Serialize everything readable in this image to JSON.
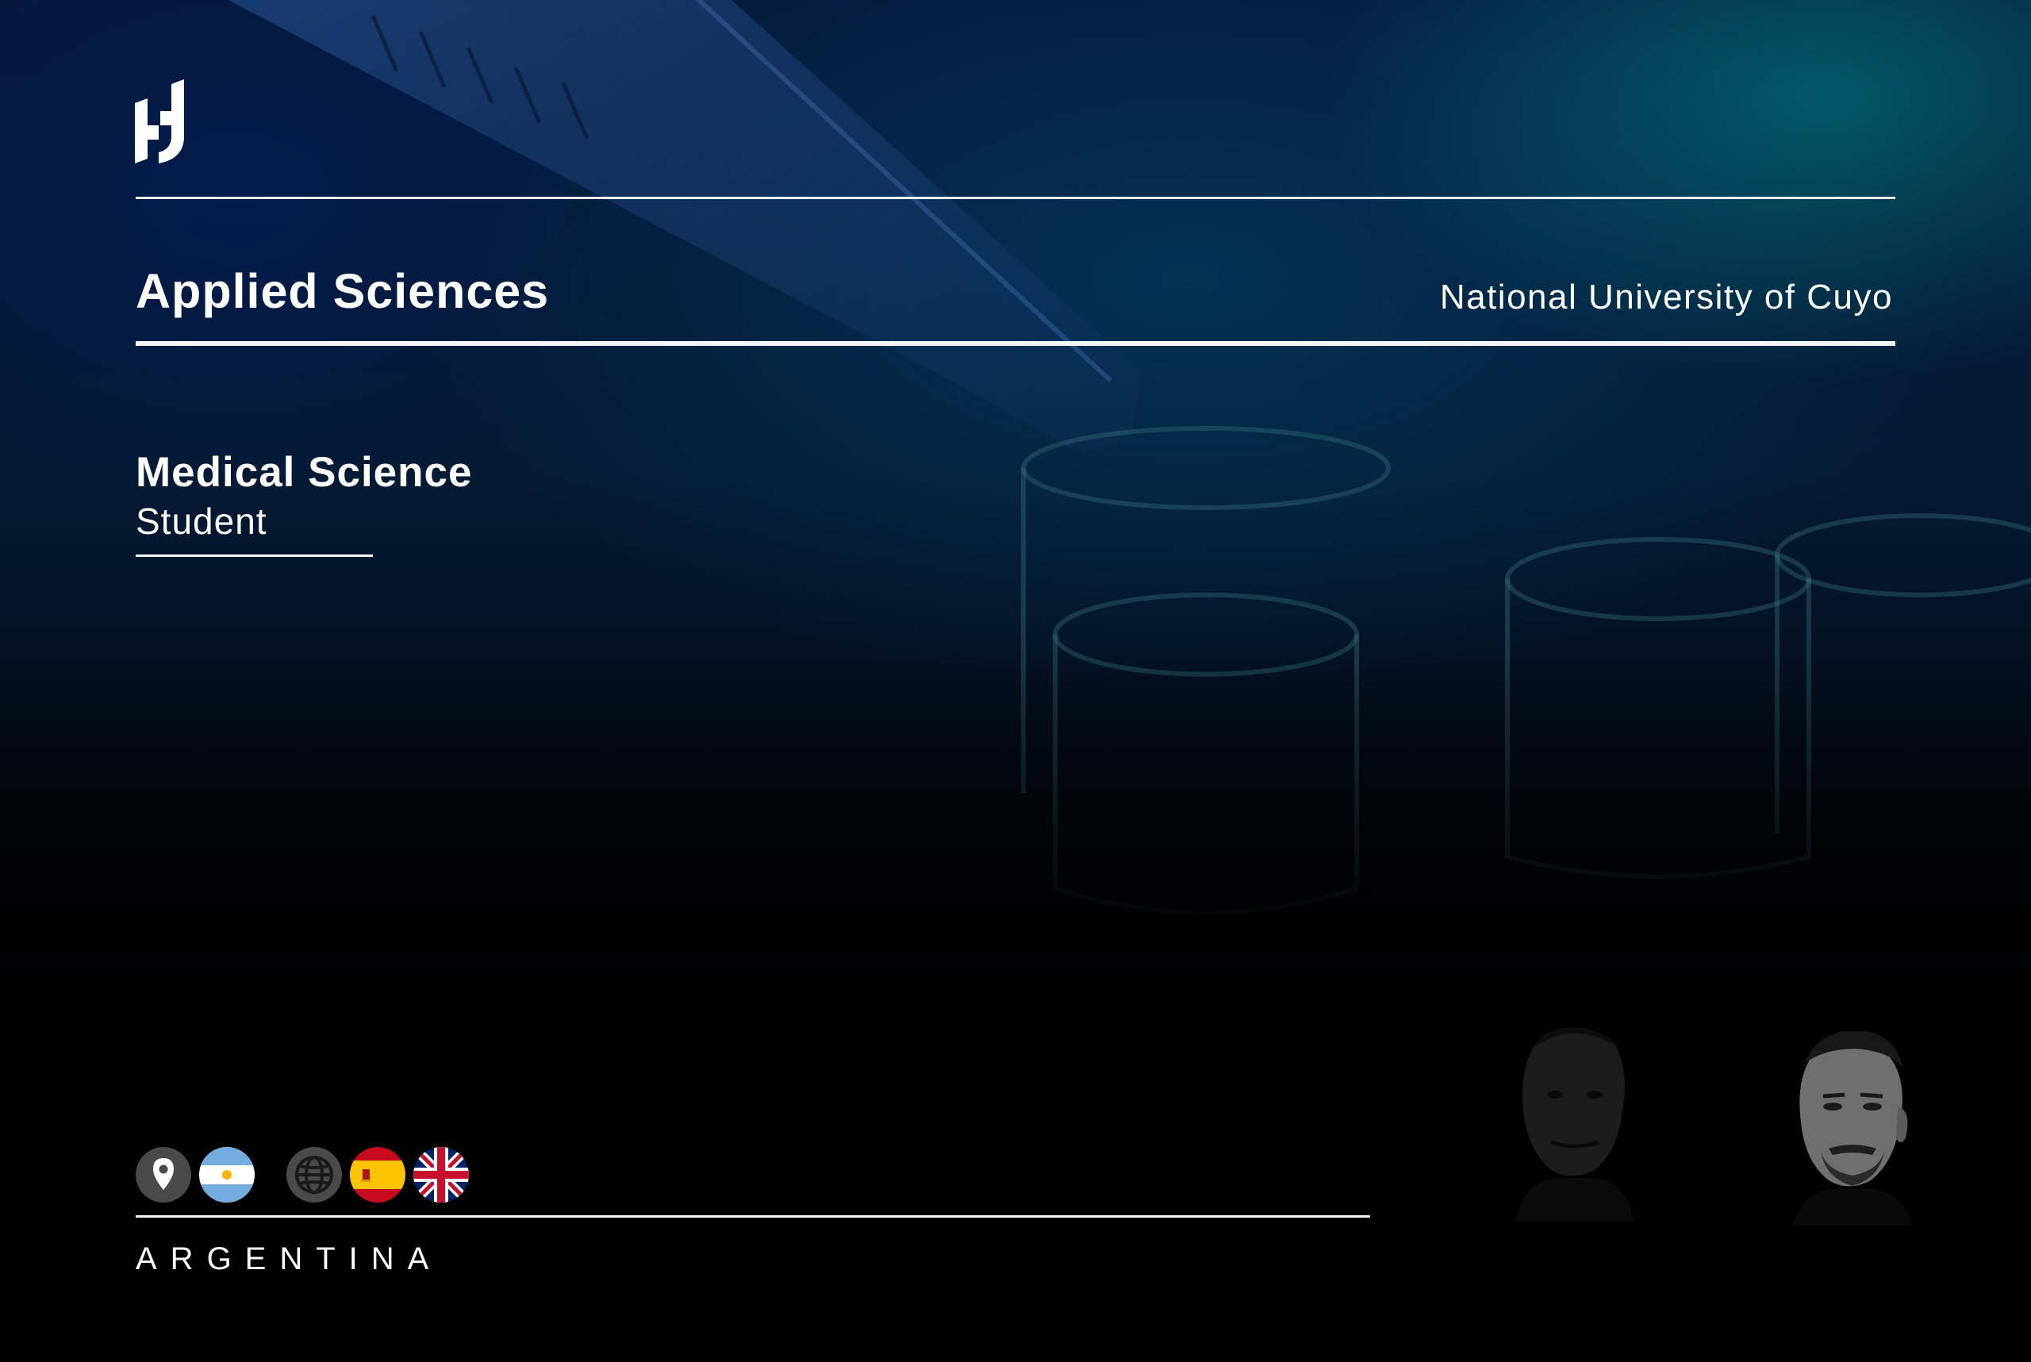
{
  "logo": {
    "icon": "monogram-h-logo"
  },
  "header": {
    "title": "Applied Sciences",
    "university": "National University of Cuyo"
  },
  "profile": {
    "field": "Medical Science",
    "role": "Student"
  },
  "footer": {
    "icons": [
      "location-pin-icon",
      "argentina-flag-icon",
      "globe-icon",
      "spain-flag-icon",
      "uk-flag-icon"
    ],
    "country": "ARGENTINA"
  },
  "colors": {
    "background": "#000000",
    "accent_teal": "#0a7f80",
    "accent_blue": "#0b2f6b",
    "text": "#ffffff"
  }
}
